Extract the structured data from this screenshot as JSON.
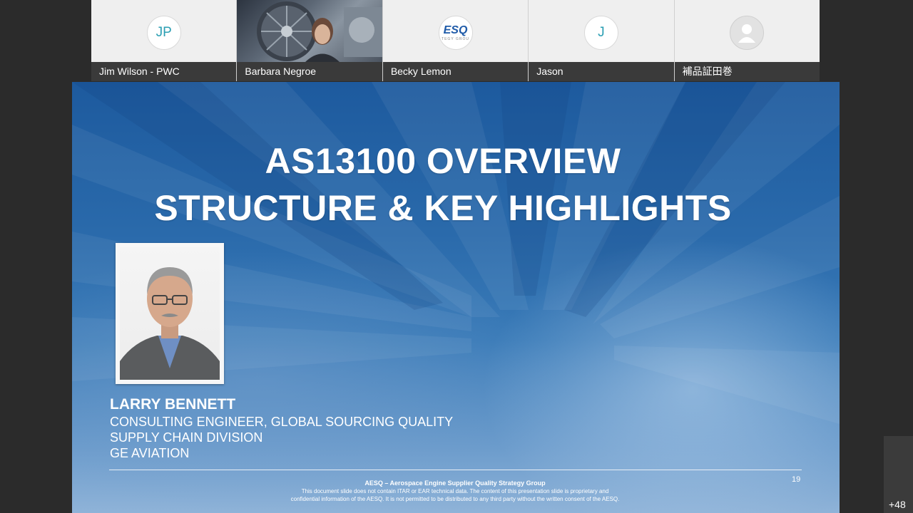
{
  "participants": [
    {
      "initials": "JP",
      "name": "Jim Wilson - PWC",
      "type": "initials"
    },
    {
      "initials": "",
      "name": "Barbara Negroe",
      "type": "video"
    },
    {
      "initials": "",
      "name": "Becky Lemon",
      "type": "logo",
      "logo_text": "ESQ",
      "logo_subtext": "TEGY GROU"
    },
    {
      "initials": "J",
      "name": "Jason",
      "type": "initials"
    },
    {
      "initials": "",
      "name": "補品証田巻",
      "type": "generic"
    }
  ],
  "slide": {
    "title_line1": "AS13100 OVERVIEW",
    "title_line2": "STRUCTURE & KEY HIGHLIGHTS",
    "presenter": {
      "name": "LARRY BENNETT",
      "line1": "CONSULTING ENGINEER, GLOBAL SOURCING QUALITY",
      "line2": "SUPPLY CHAIN DIVISION",
      "line3": "GE AVIATION"
    },
    "footer": {
      "title": "AESQ – Aerospace Engine Supplier Quality Strategy Group",
      "line1": "This document slide does not contain ITAR or EAR technical data.  The content of this presentation slide is proprietary and",
      "line2": "confidential information of the AESQ. It is not permitted to be distributed to any third party without the written consent of the AESQ."
    },
    "page_number": "19"
  },
  "overflow_count": "+48",
  "colors": {
    "slide_blue": "#1d5a9e",
    "initials_teal": "#2b9fb3",
    "name_bar": "#3a3a3a"
  }
}
